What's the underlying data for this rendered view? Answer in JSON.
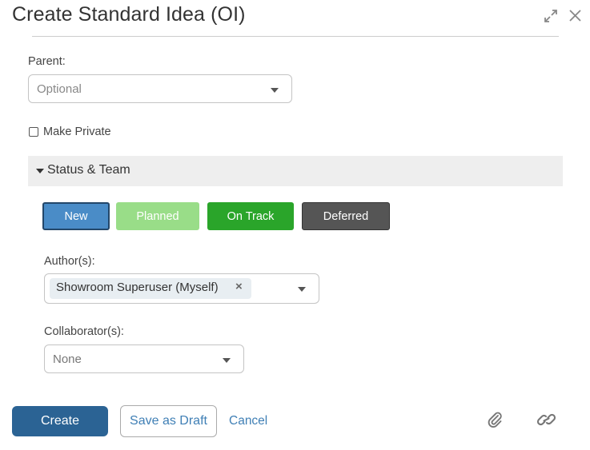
{
  "dialog": {
    "title": "Create Standard Idea (OI)"
  },
  "form": {
    "parent_label": "Parent:",
    "parent_placeholder": "Optional",
    "make_private_label": "Make Private",
    "make_private_checked": false
  },
  "status_team": {
    "section_title": "Status & Team",
    "status_buttons": [
      {
        "label": "New",
        "color": "#4a8cc7",
        "selected": true
      },
      {
        "label": "Planned",
        "color": "#99dd88",
        "selected": false
      },
      {
        "label": "On Track",
        "color": "#2aa52a",
        "selected": false
      },
      {
        "label": "Deferred",
        "color": "#555555",
        "selected": false
      }
    ],
    "authors_label": "Author(s):",
    "authors": [
      {
        "name": "Showroom Superuser (Myself)"
      }
    ],
    "collaborators_label": "Collaborator(s):",
    "collaborators_value": "None"
  },
  "footer": {
    "create_label": "Create",
    "save_draft_label": "Save as Draft",
    "cancel_label": "Cancel",
    "attach_icon": "paperclip-icon",
    "link_icon": "link-icon"
  },
  "colors": {
    "primary": "#2b6394",
    "link": "#3f7fb5"
  }
}
